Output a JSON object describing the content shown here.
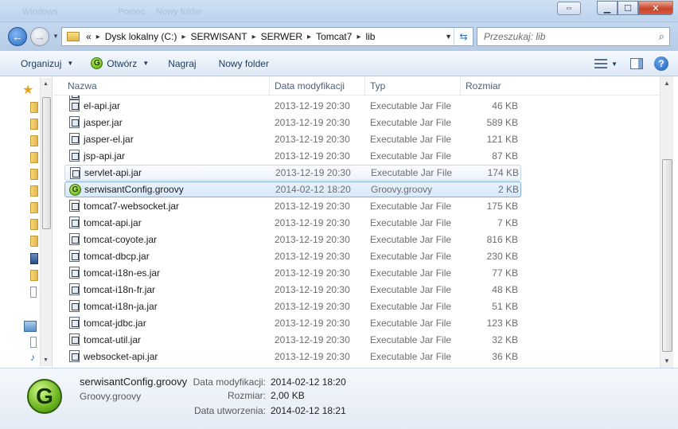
{
  "window": {
    "ghost_items": [
      "Windows",
      "Pomoc",
      "Nowy folder"
    ]
  },
  "address": {
    "overflow": "«",
    "crumbs": [
      "Dysk lokalny (C:)",
      "SERWISANT",
      "SERWER",
      "Tomcat7",
      "lib"
    ],
    "search_placeholder": "Przeszukaj: lib"
  },
  "toolbar": {
    "organize_label": "Organizuj",
    "open_label": "Otwórz",
    "burn_label": "Nagraj",
    "newfolder_label": "Nowy folder"
  },
  "columns": {
    "name": "Nazwa",
    "date": "Data modyfikacji",
    "type": "Typ",
    "size": "Rozmiar"
  },
  "files": [
    {
      "name": "el-api.jar",
      "date": "2013-12-19 20:30",
      "type": "Executable Jar File",
      "size": "46 KB",
      "icon": "jar-icon"
    },
    {
      "name": "jasper.jar",
      "date": "2013-12-19 20:30",
      "type": "Executable Jar File",
      "size": "589 KB",
      "icon": "jar-icon"
    },
    {
      "name": "jasper-el.jar",
      "date": "2013-12-19 20:30",
      "type": "Executable Jar File",
      "size": "121 KB",
      "icon": "jar-icon"
    },
    {
      "name": "jsp-api.jar",
      "date": "2013-12-19 20:30",
      "type": "Executable Jar File",
      "size": "87 KB",
      "icon": "jar-icon"
    },
    {
      "name": "servlet-api.jar",
      "date": "2013-12-19 20:30",
      "type": "Executable Jar File",
      "size": "174 KB",
      "icon": "jar-icon"
    },
    {
      "name": "serwisantConfig.groovy",
      "date": "2014-02-12 18:20",
      "type": "Groovy.groovy",
      "size": "2 KB",
      "icon": "groovy-icon"
    },
    {
      "name": "tomcat7-websocket.jar",
      "date": "2013-12-19 20:30",
      "type": "Executable Jar File",
      "size": "175 KB",
      "icon": "jar-icon"
    },
    {
      "name": "tomcat-api.jar",
      "date": "2013-12-19 20:30",
      "type": "Executable Jar File",
      "size": "7 KB",
      "icon": "jar-icon"
    },
    {
      "name": "tomcat-coyote.jar",
      "date": "2013-12-19 20:30",
      "type": "Executable Jar File",
      "size": "816 KB",
      "icon": "jar-icon"
    },
    {
      "name": "tomcat-dbcp.jar",
      "date": "2013-12-19 20:30",
      "type": "Executable Jar File",
      "size": "230 KB",
      "icon": "jar-icon"
    },
    {
      "name": "tomcat-i18n-es.jar",
      "date": "2013-12-19 20:30",
      "type": "Executable Jar File",
      "size": "77 KB",
      "icon": "jar-icon"
    },
    {
      "name": "tomcat-i18n-fr.jar",
      "date": "2013-12-19 20:30",
      "type": "Executable Jar File",
      "size": "48 KB",
      "icon": "jar-icon"
    },
    {
      "name": "tomcat-i18n-ja.jar",
      "date": "2013-12-19 20:30",
      "type": "Executable Jar File",
      "size": "51 KB",
      "icon": "jar-icon"
    },
    {
      "name": "tomcat-jdbc.jar",
      "date": "2013-12-19 20:30",
      "type": "Executable Jar File",
      "size": "123 KB",
      "icon": "jar-icon"
    },
    {
      "name": "tomcat-util.jar",
      "date": "2013-12-19 20:30",
      "type": "Executable Jar File",
      "size": "32 KB",
      "icon": "jar-icon"
    },
    {
      "name": "websocket-api.jar",
      "date": "2013-12-19 20:30",
      "type": "Executable Jar File",
      "size": "36 KB",
      "icon": "jar-icon"
    }
  ],
  "hovered_file": "servlet-api.jar",
  "selected_file": "serwisantConfig.groovy",
  "details": {
    "name": "serwisantConfig.groovy",
    "type": "Groovy.groovy",
    "modified_label": "Data modyfikacji:",
    "modified_value": "2014-02-12 18:20",
    "size_label": "Rozmiar:",
    "size_value": "2,00 KB",
    "created_label": "Data utworzenia:",
    "created_value": "2014-02-12 18:21"
  },
  "colors": {
    "accent": "#1e395b",
    "selection": "#84acdd",
    "groovy_green": "#6cb520"
  }
}
